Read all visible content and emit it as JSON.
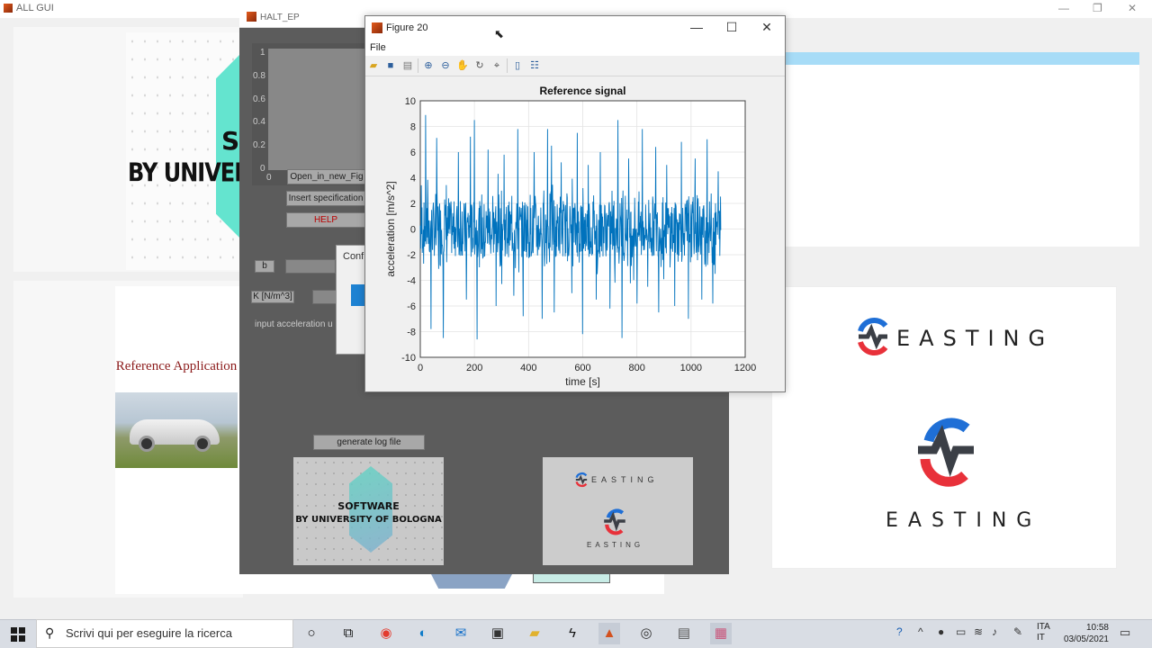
{
  "background_window": {
    "title": "ALL GUI",
    "left_logo_partial": "S",
    "left_logo_partial2": "BY UNIVERSI",
    "reference_application": "Reference Application"
  },
  "halt_window": {
    "title": "HALT_EP",
    "axes_ticks_y": [
      "1",
      "0.8",
      "0.6",
      "0.4",
      "0.2",
      "0"
    ],
    "axes_tick_x": "0",
    "open_in_new_figure": "Open_in_new_Fig",
    "insert_spec": "Insert specification",
    "help": "HELP",
    "label_b": "b",
    "label_k": "K [N/m^3]",
    "input_accel_label": "input acceleration u",
    "dialog_partial": "Conf",
    "generate_log": "generate log file",
    "software_line1": "SOFTWARE",
    "software_line2": "BY UNIVERSITY OF BOLOGNA"
  },
  "figure_window": {
    "title": "Figure 20",
    "menu_file": "File",
    "toolbar_icons": [
      "open-icon",
      "save-icon",
      "print-icon",
      "zoom-in-icon",
      "zoom-out-icon",
      "pan-icon",
      "rotate-icon",
      "data-cursor-icon",
      "colorbar-icon",
      "legend-icon"
    ]
  },
  "easting": {
    "brand": "EASTING",
    "red": "#e8313a",
    "blue": "#1f6fd6",
    "dark": "#3b3f46"
  },
  "chart_data": {
    "type": "line",
    "title": "Reference signal",
    "xlabel": "time [s]",
    "ylabel": "acceleration [m/s^2]",
    "xlim": [
      0,
      1200
    ],
    "ylim": [
      -10,
      10
    ],
    "xticks": [
      "0",
      "200",
      "400",
      "600",
      "800",
      "1000",
      "1200"
    ],
    "yticks": [
      "10",
      "8",
      "6",
      "4",
      "2",
      "0",
      "-2",
      "-4",
      "-6",
      "-8",
      "-10"
    ],
    "grid": true,
    "color": "#0072bd",
    "series": [
      {
        "x_start": 0,
        "x_end": 1110,
        "dense_band": [
          -2.2,
          2.2
        ],
        "peaks": [
          {
            "x": 20,
            "y": 8.9
          },
          {
            "x": 40,
            "y": -7.8
          },
          {
            "x": 60,
            "y": 7.1
          },
          {
            "x": 85,
            "y": -8.5
          },
          {
            "x": 140,
            "y": 6.0
          },
          {
            "x": 170,
            "y": -5.5
          },
          {
            "x": 185,
            "y": 7.2
          },
          {
            "x": 200,
            "y": 8.5
          },
          {
            "x": 210,
            "y": -8.6
          },
          {
            "x": 250,
            "y": 6.2
          },
          {
            "x": 280,
            "y": -6.0
          },
          {
            "x": 310,
            "y": 5.8
          },
          {
            "x": 345,
            "y": -5.2
          },
          {
            "x": 360,
            "y": 7.8
          },
          {
            "x": 380,
            "y": -6.8
          },
          {
            "x": 420,
            "y": 6.0
          },
          {
            "x": 450,
            "y": -7.0
          },
          {
            "x": 470,
            "y": 7.8
          },
          {
            "x": 485,
            "y": 6.5
          },
          {
            "x": 495,
            "y": -6.5
          },
          {
            "x": 520,
            "y": 5.2
          },
          {
            "x": 560,
            "y": -5.0
          },
          {
            "x": 580,
            "y": 7.5
          },
          {
            "x": 600,
            "y": -8.2
          },
          {
            "x": 620,
            "y": 5.0
          },
          {
            "x": 650,
            "y": -5.5
          },
          {
            "x": 665,
            "y": 6.0
          },
          {
            "x": 700,
            "y": -6.2
          },
          {
            "x": 730,
            "y": 8.5
          },
          {
            "x": 745,
            "y": -8.5
          },
          {
            "x": 770,
            "y": 5.5
          },
          {
            "x": 800,
            "y": -5.8
          },
          {
            "x": 820,
            "y": 7.8
          },
          {
            "x": 840,
            "y": -4.5
          },
          {
            "x": 870,
            "y": 6.4
          },
          {
            "x": 880,
            "y": -6.5
          },
          {
            "x": 910,
            "y": 5.0
          },
          {
            "x": 940,
            "y": -6.0
          },
          {
            "x": 965,
            "y": 6.8
          },
          {
            "x": 990,
            "y": -7.0
          },
          {
            "x": 1015,
            "y": 5.5
          },
          {
            "x": 1040,
            "y": -5.5
          },
          {
            "x": 1060,
            "y": 7.0
          },
          {
            "x": 1080,
            "y": -5.8
          },
          {
            "x": 1100,
            "y": 4.5
          }
        ]
      }
    ]
  },
  "taskbar": {
    "search_placeholder": "Scrivi qui per eseguire la ricerca",
    "lang1": "ITA",
    "lang2": "IT",
    "time": "10:58",
    "date": "03/05/2021"
  }
}
